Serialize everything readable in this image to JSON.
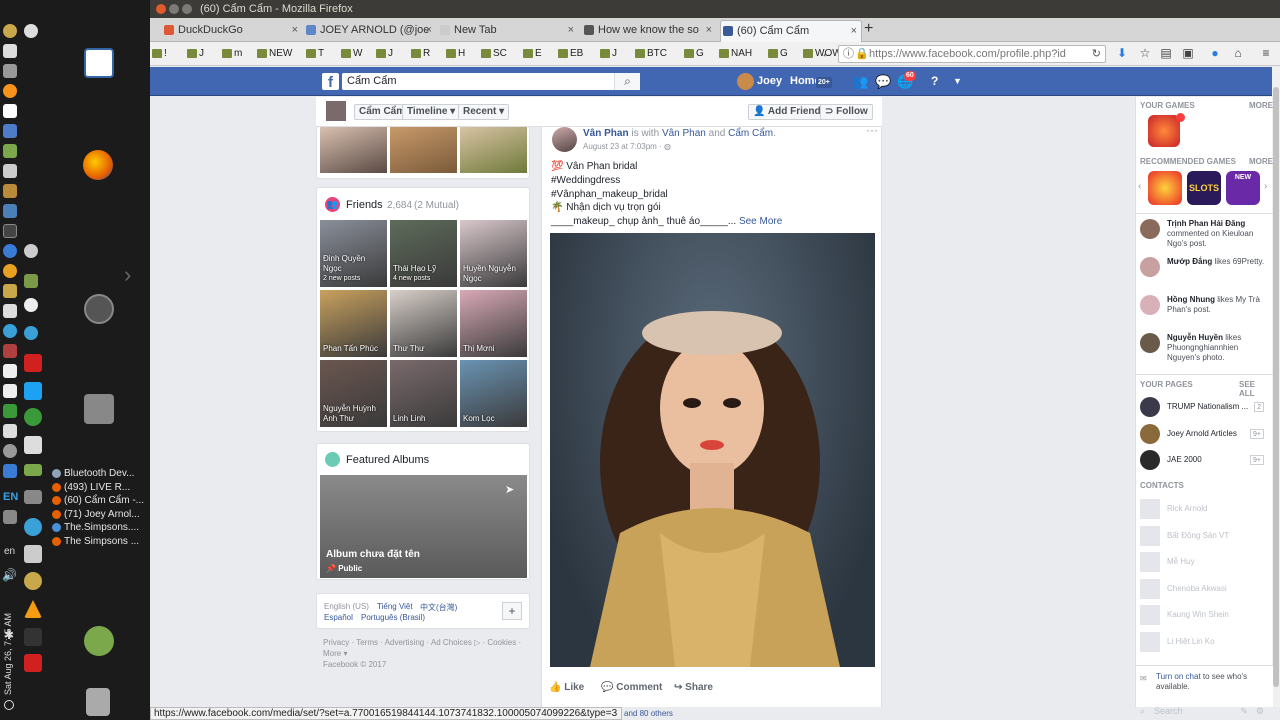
{
  "os": {
    "taskbar_items": [
      {
        "label": "Bluetooth Dev...",
        "color": "#8fa3b8"
      },
      {
        "label": "(493) LIVE R...",
        "color": "#e66000"
      },
      {
        "label": "(60) Cẩm Cẩm -...",
        "color": "#e66000"
      },
      {
        "label": "(71) Joey Arnol...",
        "color": "#e66000"
      },
      {
        "label": "The.Simpsons....",
        "color": "#4a90d9"
      },
      {
        "label": "The Simpsons ...",
        "color": "#e66000"
      }
    ],
    "lang_short": "EN",
    "lang": "en",
    "clock": "Sat Aug 26, 7:15 AM"
  },
  "window": {
    "title": "(60) Cẩm Cẩm - Mozilla Firefox"
  },
  "tabs": [
    {
      "label": "DuckDuckGo",
      "color": "#de5833"
    },
    {
      "label": "JOEY ARNOLD (@joe",
      "color": "#5f87c7"
    },
    {
      "label": "New Tab",
      "color": "#cccccc"
    },
    {
      "label": "How we know the so",
      "color": "#555555"
    },
    {
      "label": "(60) Cẩm Cẩm",
      "color": "#3b5998"
    }
  ],
  "bookmarks": [
    "!",
    "J",
    "m",
    "NEW",
    "T",
    "W",
    "J",
    "R",
    "H",
    "SC",
    "E",
    "EB",
    "J",
    "BTC",
    "G",
    "NAH",
    "G",
    "WOW"
  ],
  "url": "https://www.facebook.com/profile.php?id",
  "fb": {
    "search_value": "Cẩm Cẩm",
    "user": "Joey",
    "home": "Home",
    "home_count": "20+",
    "notif_count": "60"
  },
  "profile_bar": {
    "name": "Cẩm Cẩm",
    "timeline": "Timeline",
    "recent": "Recent",
    "add_friend": "Add Friend",
    "follow": "Follow"
  },
  "friends": {
    "title": "Friends",
    "count": "2,684",
    "mutual": "(2 Mutual)",
    "items": [
      {
        "name": "Đinh Quyền Ngọc",
        "sub": "2 new posts",
        "color": "#8a8f9a"
      },
      {
        "name": "Thái Hạo Lỹ",
        "sub": "4 new posts",
        "color": "#5e6b5a"
      },
      {
        "name": "Huyền Nguyễn Ngọc",
        "sub": "",
        "color": "#d9c8cc"
      },
      {
        "name": "Phan Tấn Phúc",
        "sub": "",
        "color": "#c9a15e"
      },
      {
        "name": "Thư Thư",
        "sub": "",
        "color": "#d8cfc9"
      },
      {
        "name": "Thị Mơni",
        "sub": "",
        "color": "#d8a9b6"
      },
      {
        "name": "Nguyễn Huỳnh Anh Thư",
        "sub": "",
        "color": "#6b5650"
      },
      {
        "name": "Linh Linh",
        "sub": "",
        "color": "#7a6a6c"
      },
      {
        "name": "Kom Lọc",
        "sub": "",
        "color": "#6a93b3"
      }
    ]
  },
  "albums": {
    "title": "Featured Albums",
    "album_name": "Album chưa đặt tên",
    "privacy": "Public"
  },
  "footer": {
    "languages": [
      "English (US)",
      "Tiếng Việt",
      "中文(台灣)",
      "Español",
      "Português (Brasil)"
    ],
    "links": [
      "Privacy",
      "Terms",
      "Advertising",
      "Ad Choices",
      "Cookies",
      "More"
    ],
    "copyright": "Facebook © 2017"
  },
  "post": {
    "author": "Vân Phan",
    "with_text": "is with",
    "tagged1": "Vân Phan",
    "and_text": "and",
    "tagged2": "Cẩm Cẩm",
    "date": "August 23 at 7:03pm",
    "line1": "💯 Vân Phan bridal",
    "line2": "#Weddingdress",
    "line3": "#Vânphan_makeup_bridal",
    "line4": "🌴 Nhận dịch vụ trọn gói",
    "line5": "____makeup_ chụp ảnh_ thuê áo_____...",
    "see_more": "See More",
    "like": "Like",
    "comment": "Comment",
    "share": "Share",
    "likes_summary": "and 80 others"
  },
  "right": {
    "your_games": "YOUR GAMES",
    "more": "MORE",
    "recommended_games": "RECOMMENDED GAMES",
    "game_slots": "SLOTS",
    "game_new": "NEW",
    "ticker": [
      {
        "name": "Trịnh Phan Hải Đăng",
        "text": "commented on Kieuloan Ngo's post."
      },
      {
        "name": "Mướp Đắng",
        "text": "likes 69Pretty."
      },
      {
        "name": "Hồng Nhung",
        "text": "likes My Trà Phan's post."
      },
      {
        "name": "Nguyễn Huyền",
        "text": "likes Phuongnghiannhien Nguyen's photo."
      }
    ],
    "your_pages": "YOUR PAGES",
    "see_all": "SEE ALL",
    "pages": [
      {
        "name": "TRUMP Nationalism ...",
        "count": "2"
      },
      {
        "name": "Joey Arnold Articles",
        "count": "9+"
      },
      {
        "name": "JAE 2000",
        "count": "9+"
      }
    ],
    "contacts": "CONTACTS",
    "contact_list": [
      "Rick Arnold",
      "Bất Động Sản VT",
      "Mễ Huy",
      "Chenoba Akwasi",
      "Kaung Win Shein",
      "Li Hiệt Lin Ko"
    ],
    "chat_link": "Turn on chat",
    "chat_text": "to see who's available.",
    "search_placeholder": "Search"
  },
  "status_url": "https://www.facebook.com/media/set/?set=a.770016519844144.1073741832.100005074099226&type=3"
}
